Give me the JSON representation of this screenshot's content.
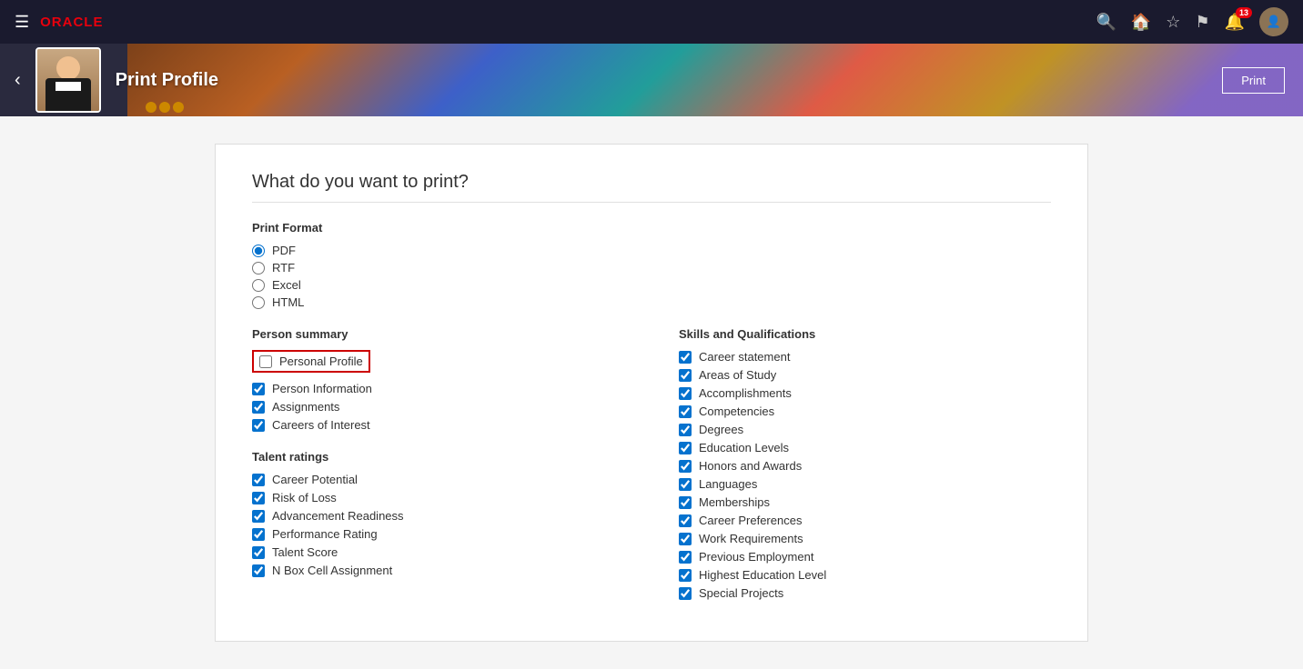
{
  "topbar": {
    "logo": "ORACLE",
    "notification_count": "13",
    "menu_icon": "☰"
  },
  "profile": {
    "name": "Print Profile",
    "print_button": "Print"
  },
  "page": {
    "title": "What do you want to print?"
  },
  "print_format": {
    "label": "Print Format",
    "options": [
      "PDF",
      "RTF",
      "Excel",
      "HTML"
    ],
    "selected": "PDF"
  },
  "person_summary": {
    "title": "Person summary",
    "items": [
      {
        "label": "Personal Profile",
        "checked": false,
        "highlighted": true
      },
      {
        "label": "Person Information",
        "checked": true
      },
      {
        "label": "Assignments",
        "checked": true
      },
      {
        "label": "Careers of Interest",
        "checked": true
      }
    ]
  },
  "talent_ratings": {
    "title": "Talent ratings",
    "items": [
      {
        "label": "Career Potential",
        "checked": true
      },
      {
        "label": "Risk of Loss",
        "checked": true
      },
      {
        "label": "Advancement Readiness",
        "checked": true
      },
      {
        "label": "Performance Rating",
        "checked": true
      },
      {
        "label": "Talent Score",
        "checked": true
      },
      {
        "label": "N Box Cell Assignment",
        "checked": true
      }
    ]
  },
  "skills_qualifications": {
    "title": "Skills and Qualifications",
    "items": [
      {
        "label": "Career statement",
        "checked": true
      },
      {
        "label": "Areas of Study",
        "checked": true
      },
      {
        "label": "Accomplishments",
        "checked": true
      },
      {
        "label": "Competencies",
        "checked": true
      },
      {
        "label": "Degrees",
        "checked": true
      },
      {
        "label": "Education Levels",
        "checked": true
      },
      {
        "label": "Honors and Awards",
        "checked": true
      },
      {
        "label": "Languages",
        "checked": true
      },
      {
        "label": "Memberships",
        "checked": true
      },
      {
        "label": "Career Preferences",
        "checked": true
      },
      {
        "label": "Work Requirements",
        "checked": true
      },
      {
        "label": "Previous Employment",
        "checked": true
      },
      {
        "label": "Highest Education Level",
        "checked": true
      },
      {
        "label": "Special Projects",
        "checked": true
      }
    ]
  }
}
